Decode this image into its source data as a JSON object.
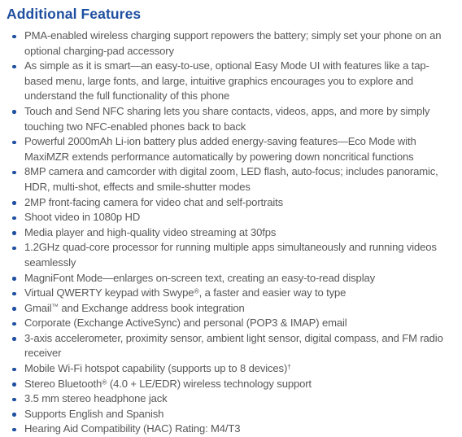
{
  "document": {
    "heading": "Additional Features",
    "heading_color": "#1F4FA0",
    "body_color": "#585858",
    "bullet_color": "#1F4FA0",
    "background_color": "#FFFFFF",
    "bullet_icon": "bullet-dot-icon"
  },
  "features": [
    {
      "text": "PMA-enabled wireless charging support repowers the battery; simply set your phone on an optional charging-pad accessory"
    },
    {
      "text": "As simple as it is smart—an easy-to-use, optional Easy Mode UI with features like a tap-based menu, large fonts, and large, intuitive graphics encourages you to explore and understand the full functionality of this phone"
    },
    {
      "text": "Touch and Send NFC sharing lets you share contacts, videos, apps, and more by simply touching two NFC-enabled phones back to back"
    },
    {
      "text": "Powerful 2000mAh Li-ion battery plus added energy-saving features—Eco Mode with MaxiMZR extends performance automatically by powering down noncritical functions"
    },
    {
      "text": "8MP camera and camcorder with digital zoom, LED flash, auto-focus; includes panoramic, HDR, multi-shot, effects and smile-shutter modes"
    },
    {
      "text": "2MP front-facing camera for video chat and self-portraits"
    },
    {
      "text": "Shoot video in 1080p HD"
    },
    {
      "text": "Media player and high-quality video streaming at 30fps"
    },
    {
      "text": "1.2GHz quad-core processor for running multiple apps simultaneously and running videos seamlessly"
    },
    {
      "text": "MagniFont Mode—enlarges on-screen text, creating an easy-to-read display"
    },
    {
      "html": "Virtual QWERTY keypad with Swype<sup>®</sup>, a faster and easier way to type"
    },
    {
      "html": "Gmail<sup>™</sup> and Exchange address book integration"
    },
    {
      "text": "Corporate (Exchange ActiveSync) and personal (POP3 & IMAP) email"
    },
    {
      "text": "3-axis accelerometer, proximity sensor, ambient light sensor, digital compass, and FM radio receiver"
    },
    {
      "html": "Mobile Wi-Fi hotspot capability (supports up to 8 devices)<sup>†</sup>"
    },
    {
      "html": "Stereo Bluetooth<sup>®</sup> (4.0 + LE/EDR) wireless technology support"
    },
    {
      "text": "3.5 mm stereo headphone jack"
    },
    {
      "text": "Supports English and Spanish"
    },
    {
      "text": "Hearing Aid Compatibility (HAC) Rating: M4/T3"
    }
  ]
}
